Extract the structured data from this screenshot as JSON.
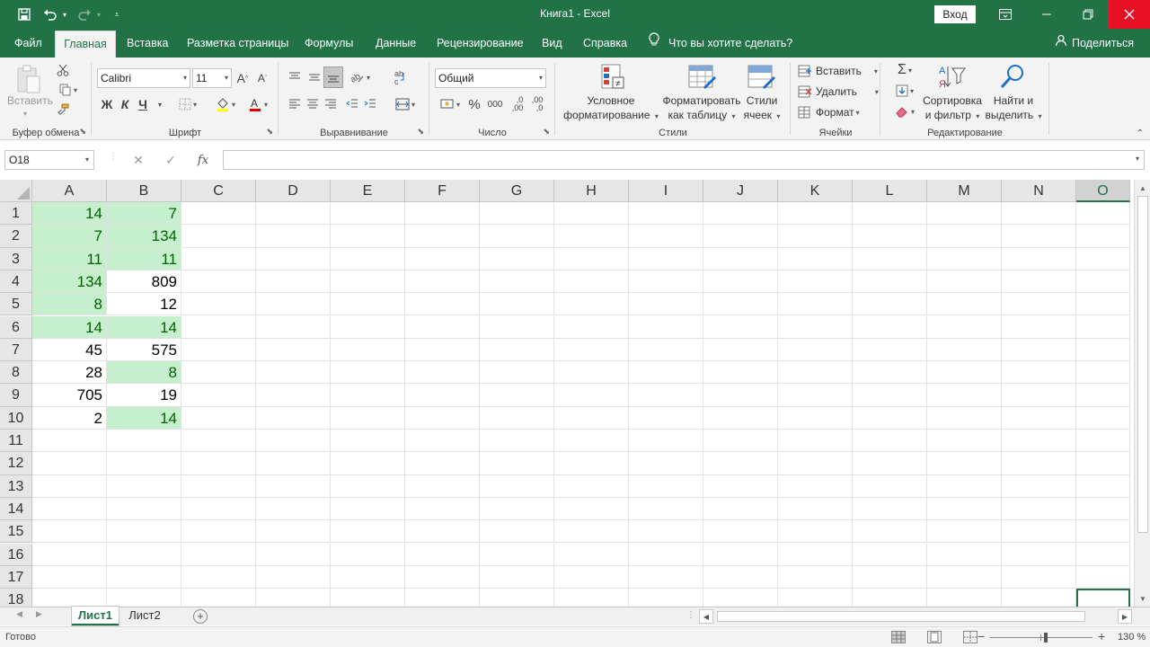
{
  "titlebar": {
    "title": "Книга1  -  Excel",
    "signin": "Вход",
    "icons": [
      "save-icon",
      "undo-icon",
      "redo-icon",
      "customize-icon",
      "ribbon-display-icon",
      "minimize-icon",
      "restore-icon",
      "close-icon"
    ]
  },
  "tabs": [
    "Файл",
    "Главная",
    "Вставка",
    "Разметка страницы",
    "Формулы",
    "Данные",
    "Рецензирование",
    "Вид",
    "Справка"
  ],
  "active_tab": "Главная",
  "tellme": "Что вы хотите сделать?",
  "share": "Поделиться",
  "ribbon": {
    "clipboard": {
      "label": "Буфер обмена",
      "paste": "Вставить"
    },
    "font": {
      "label": "Шрифт",
      "font_name": "Calibri",
      "font_size": "11",
      "bold": "Ж",
      "italic": "К",
      "underline": "Ч"
    },
    "alignment": {
      "label": "Выравнивание"
    },
    "number": {
      "label": "Число",
      "format": "Общий",
      "percent": "%",
      "thousands": "000",
      "inc_decimal": ",0\n,00",
      "dec_decimal": ",00\n,0"
    },
    "styles": {
      "label": "Стили",
      "conditional_1": "Условное",
      "conditional_2": "форматирование",
      "table_1": "Форматировать",
      "table_2": "как таблицу",
      "cell_1": "Стили",
      "cell_2": "ячеек"
    },
    "cells": {
      "label": "Ячейки",
      "insert": "Вставить",
      "delete": "Удалить",
      "format": "Формат"
    },
    "editing": {
      "label": "Редактирование",
      "sort_1": "Сортировка",
      "sort_2": "и фильтр",
      "find_1": "Найти и",
      "find_2": "выделить",
      "sigma": "Σ"
    }
  },
  "formula_bar": {
    "name_box": "O18",
    "fx": "fx",
    "cancel": "✕",
    "enter": "✓",
    "value": ""
  },
  "columns": [
    "A",
    "B",
    "C",
    "D",
    "E",
    "F",
    "G",
    "H",
    "I",
    "J",
    "K",
    "L",
    "M",
    "N",
    "O"
  ],
  "selected_column": "O",
  "rows": [
    "1",
    "2",
    "3",
    "4",
    "5",
    "6",
    "7",
    "8",
    "9",
    "10",
    "11",
    "12",
    "13",
    "14",
    "15",
    "16",
    "17",
    "18"
  ],
  "active_cell": "O18",
  "cells": {
    "A": [
      "14",
      "7",
      "11",
      "134",
      "8",
      "14",
      "45",
      "28",
      "705",
      "2"
    ],
    "B": [
      "7",
      "134",
      "11",
      "809",
      "12",
      "14",
      "575",
      "8",
      "19",
      "14"
    ]
  },
  "highlight": {
    "A": [
      true,
      true,
      true,
      true,
      true,
      true,
      false,
      false,
      false,
      false
    ],
    "B": [
      true,
      true,
      true,
      false,
      false,
      true,
      false,
      true,
      false,
      true
    ]
  },
  "highlight_fill": "#c6efce",
  "highlight_text": "#006100",
  "accent": "#217346",
  "sheets": [
    "Лист1",
    "Лист2"
  ],
  "active_sheet": "Лист1",
  "status": {
    "ready": "Готово",
    "zoom": "130 %",
    "zoom_minus": "−",
    "zoom_plus": "+"
  }
}
